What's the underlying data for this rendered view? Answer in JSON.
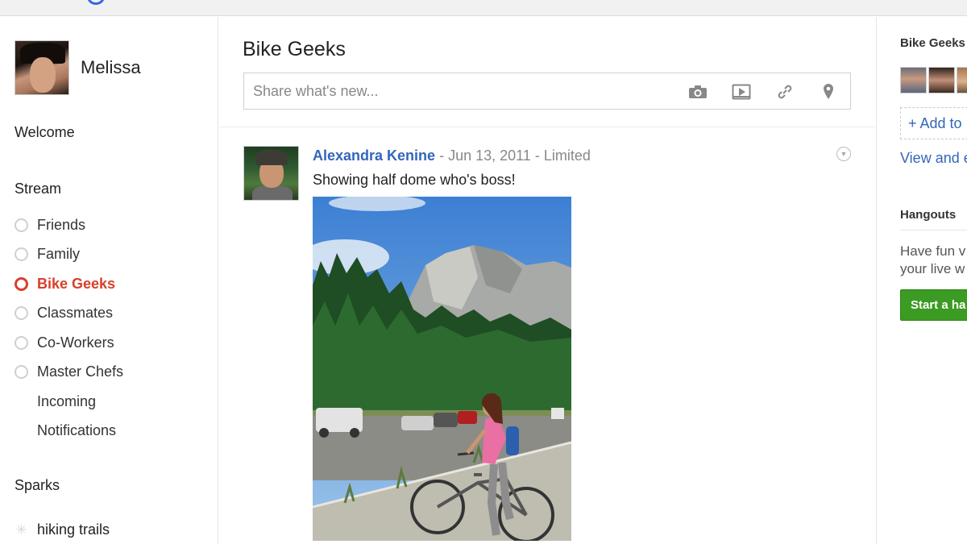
{
  "profile": {
    "name": "Melissa"
  },
  "nav": {
    "welcome": "Welcome",
    "stream": "Stream",
    "circles": [
      {
        "label": "Friends",
        "active": false,
        "ring": true
      },
      {
        "label": "Family",
        "active": false,
        "ring": true
      },
      {
        "label": "Bike Geeks",
        "active": true,
        "ring": true
      },
      {
        "label": "Classmates",
        "active": false,
        "ring": true
      },
      {
        "label": "Co-Workers",
        "active": false,
        "ring": true
      },
      {
        "label": "Master Chefs",
        "active": false,
        "ring": true
      },
      {
        "label": "Incoming",
        "active": false,
        "ring": false
      },
      {
        "label": "Notifications",
        "active": false,
        "ring": false
      }
    ],
    "sparks": "Sparks",
    "spark_items": [
      {
        "label": "hiking trails",
        "icon": "sparkle-icon"
      }
    ]
  },
  "main": {
    "circle_title": "Bike Geeks",
    "share": {
      "placeholder": "Share what's new...",
      "tools": [
        "camera-icon",
        "video-icon",
        "link-icon",
        "location-icon"
      ]
    },
    "post": {
      "author": "Alexandra Kenine",
      "date": "Jun 13, 2011",
      "visibility": "Limited",
      "separator": " - ",
      "text": "Showing half dome who's boss!"
    }
  },
  "right": {
    "circle_title": "Bike Geeks",
    "add_label": "+ Add to",
    "view_label": "View and e",
    "hangouts_title": "Hangouts",
    "hangouts_desc_line1": "Have fun v",
    "hangouts_desc_line2": "your live w",
    "start_button": "Start a ha"
  },
  "colors": {
    "accent_active": "#d93f2a",
    "link": "#3366bb",
    "hangout_button": "#3b9b22"
  }
}
